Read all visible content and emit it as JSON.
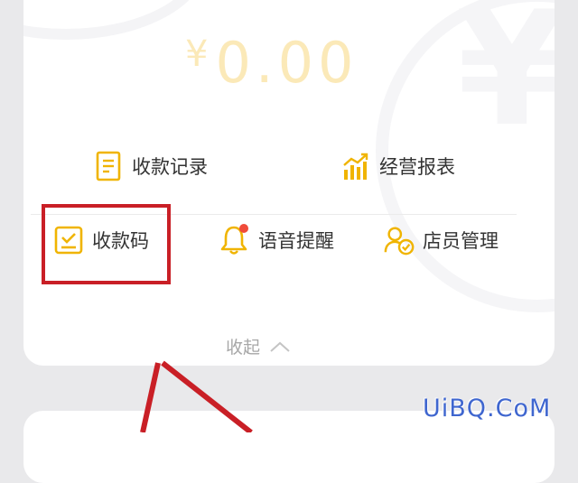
{
  "balance": {
    "currency": "¥",
    "amount": "0.00"
  },
  "actions": {
    "payment_records": {
      "label": "收款记录",
      "icon": "document-icon"
    },
    "business_report": {
      "label": "经营报表",
      "icon": "bar-chart-icon"
    },
    "payment_code": {
      "label": "收款码",
      "icon": "qr-code-card-icon"
    },
    "voice_alert": {
      "label": "语音提醒",
      "icon": "bell-icon",
      "has_badge": true
    },
    "staff_management": {
      "label": "店员管理",
      "icon": "staff-check-icon"
    }
  },
  "collapse": {
    "label": "收起",
    "icon": "chevron-up-icon"
  },
  "annotation": {
    "color": "#c91f26",
    "highlighted": "payment_code"
  },
  "watermark": {
    "text": "UiBQ.CoM"
  },
  "colors": {
    "accent_yellow": "#f0b400",
    "badge_red": "#f04b3a",
    "balance_faded": "#fbe9b8",
    "text_primary": "#333333",
    "text_muted": "#a7a7a7"
  }
}
